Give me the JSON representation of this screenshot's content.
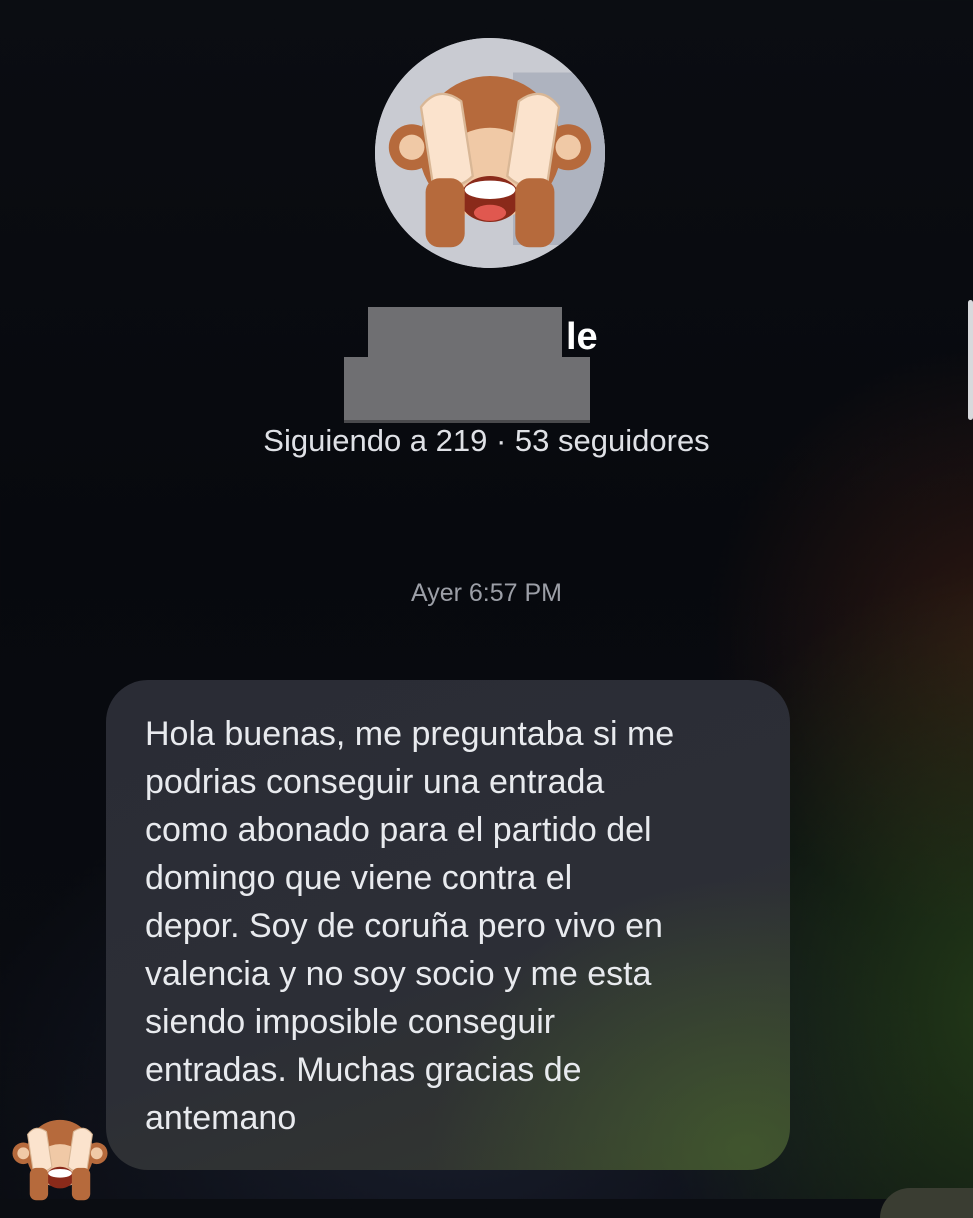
{
  "profile": {
    "name_visible_suffix": "le",
    "stats": "Siguiendo a 219 · 53 seguidores",
    "avatar_icon": "see-no-evil-monkey-icon"
  },
  "thread": {
    "timestamp": "Ayer 6:57 PM",
    "message_text": "Hola buenas, me preguntaba si me\npodrias conseguir una entrada\ncomo abonado para el partido del\ndomingo que viene contra el\ndepor. Soy de coruña pero vivo en\nvalencia y no soy socio y me esta\nsiendo imposible conseguir\nentradas. Muchas gracias de\nantemano",
    "sender_avatar_icon": "see-no-evil-monkey-icon"
  },
  "colors": {
    "background": "#07090e",
    "bubble": "#2c2e36",
    "text_primary": "#e8eaee",
    "text_muted": "#9c9fa7",
    "redaction": "#6f6f72"
  }
}
